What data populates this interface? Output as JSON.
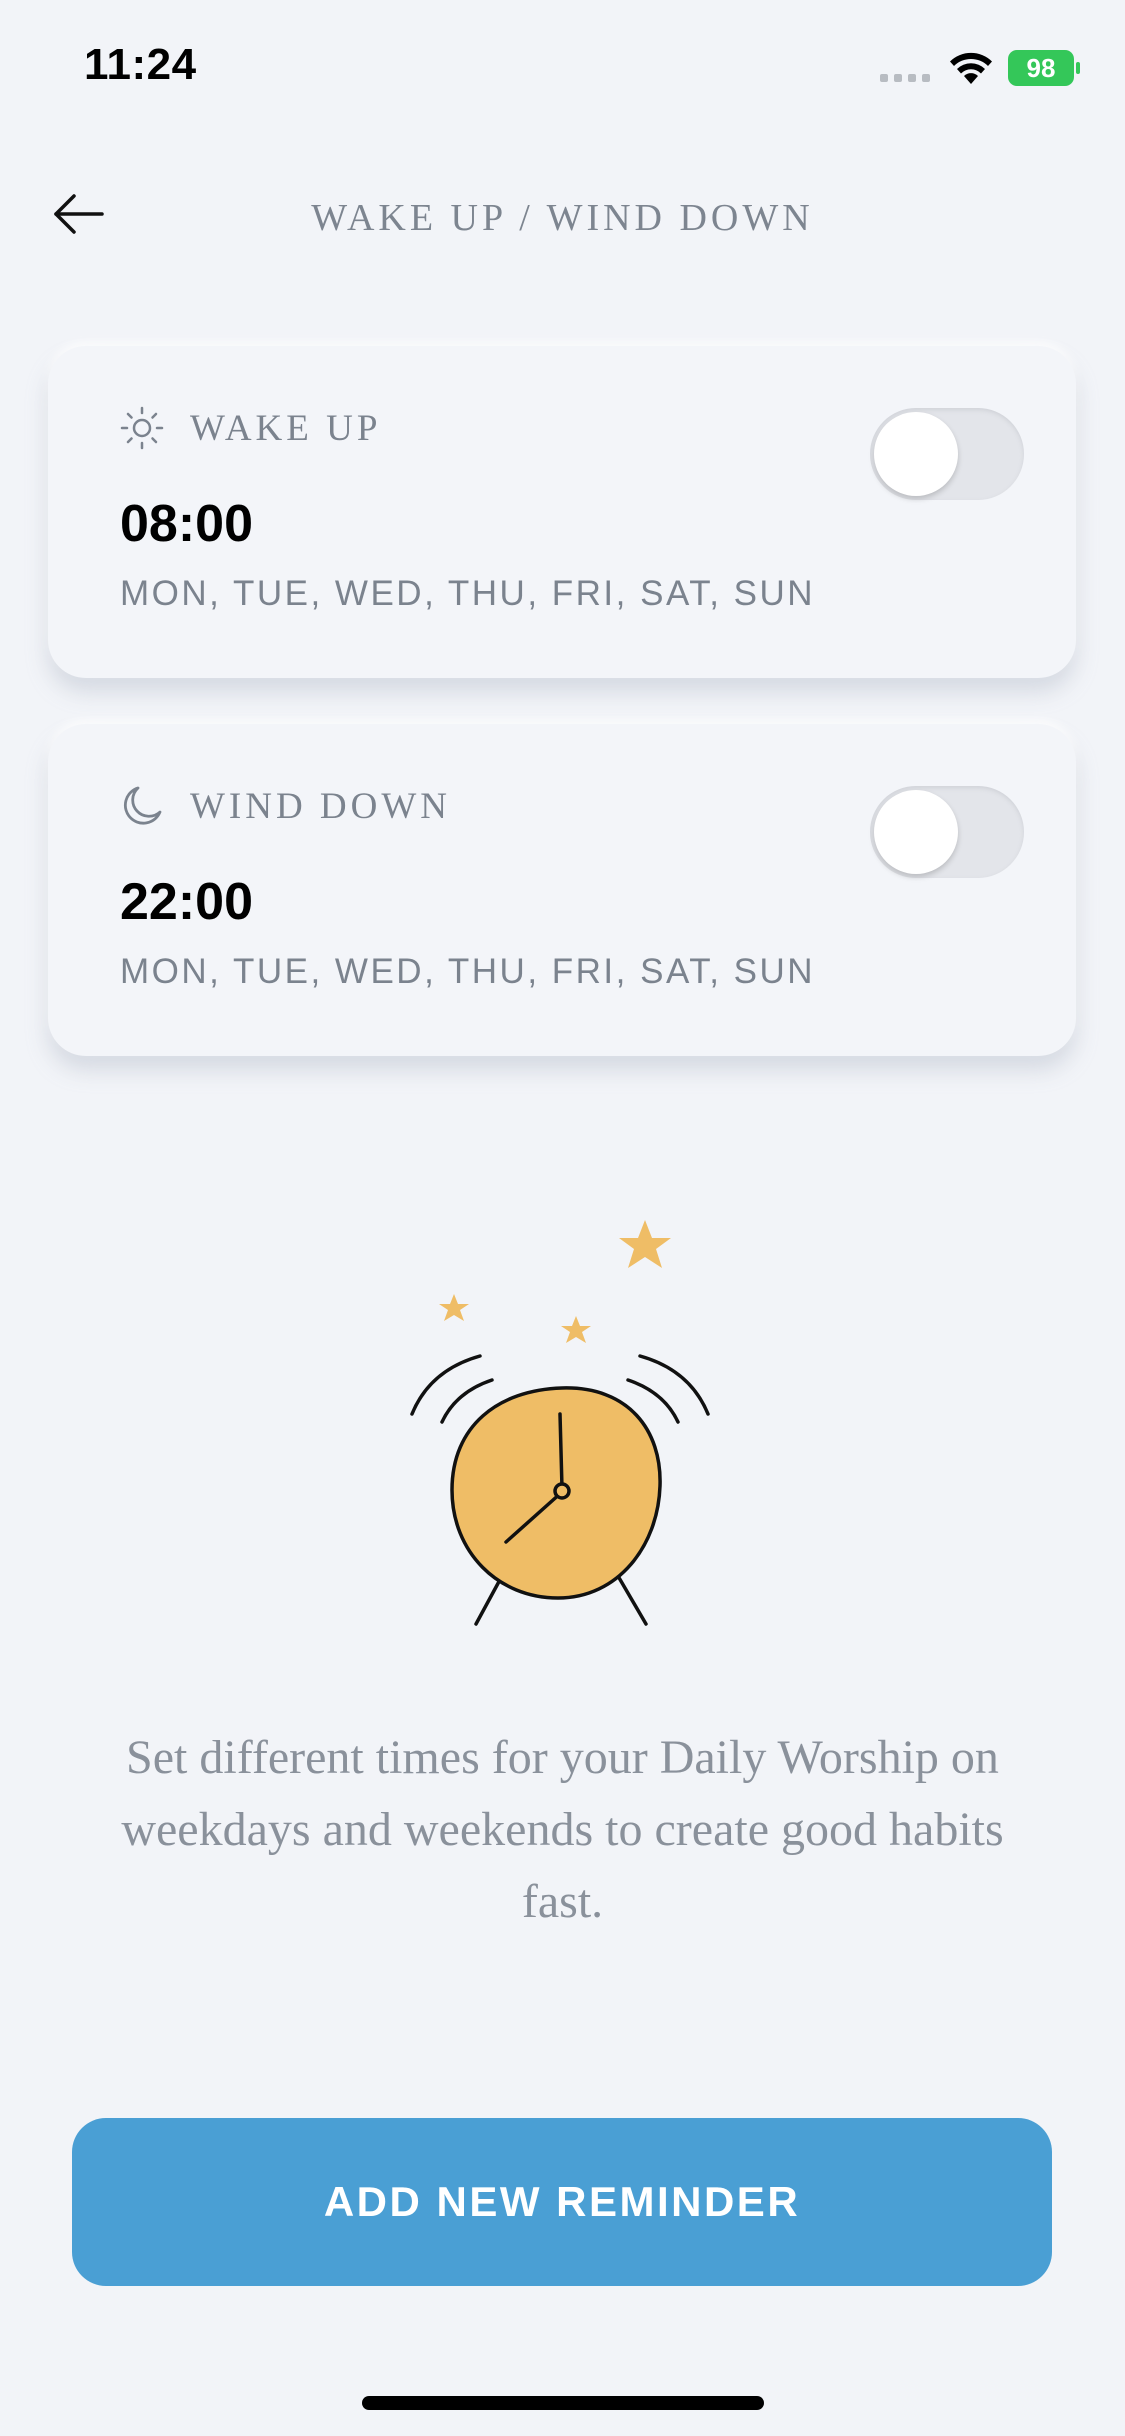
{
  "status_bar": {
    "time": "11:24",
    "battery": "98"
  },
  "header": {
    "title": "WAKE UP / WIND DOWN",
    "back_icon": "arrow-left-icon"
  },
  "reminders": [
    {
      "label": "WAKE UP",
      "icon": "sun-icon",
      "time": "08:00",
      "days": "MON, TUE, WED, THU, FRI, SAT, SUN",
      "enabled": false
    },
    {
      "label": "WIND DOWN",
      "icon": "moon-icon",
      "time": "22:00",
      "days": "MON, TUE, WED, THU, FRI, SAT, SUN",
      "enabled": false
    }
  ],
  "illustration": {
    "icon": "alarm-clock-icon",
    "colors": {
      "clock_face": "#efbd66",
      "stars": "#efbd66"
    }
  },
  "description": "Set different times for your Daily Worship on weekdays and weekends to create good habits fast.",
  "primary_button": {
    "label": "ADD NEW REMINDER",
    "color": "#4a9fd4"
  }
}
